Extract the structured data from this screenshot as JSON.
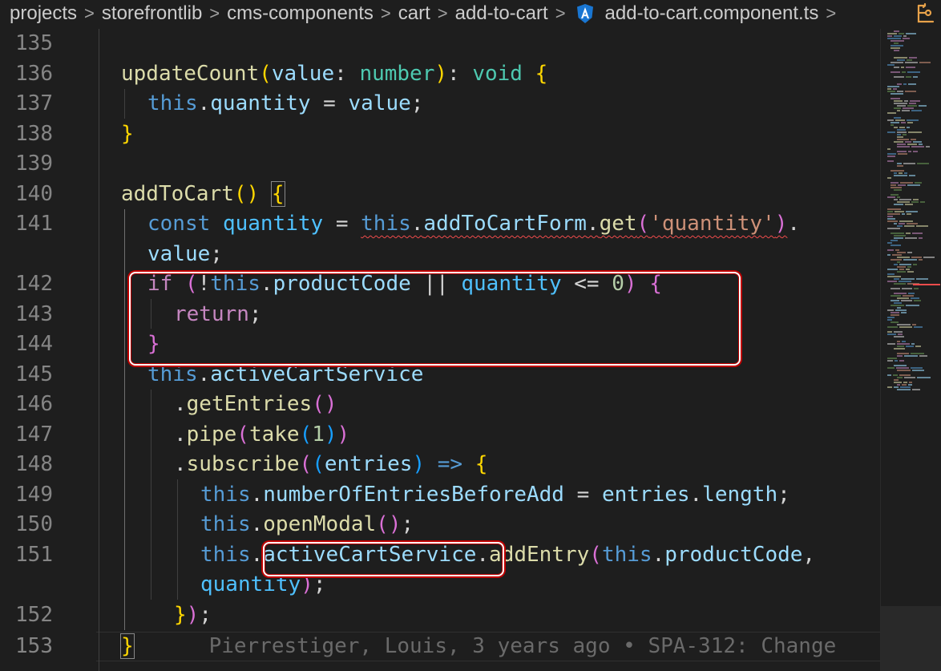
{
  "breadcrumb": {
    "items": [
      "projects",
      "storefrontlib",
      "cms-components",
      "cart",
      "add-to-cart"
    ],
    "file": "add-to-cart.component.ts",
    "separator": ">",
    "icons": {
      "angular": "angular-logo-icon",
      "right": "split-editor-icon"
    }
  },
  "line_numbers": [
    "135",
    "136",
    "137",
    "138",
    "139",
    "140",
    "141",
    "142",
    "143",
    "144",
    "145",
    "146",
    "147",
    "148",
    "149",
    "150",
    "151",
    "152",
    "153"
  ],
  "code": {
    "l136": {
      "name": "updateCount",
      "param": "value",
      "type": "number",
      "ret": "void"
    },
    "l137": {
      "this": "this",
      "prop": "quantity",
      "val": "value"
    },
    "l140": {
      "name": "addToCart"
    },
    "l141": {
      "kw": "const",
      "var": "quantity",
      "this": "this",
      "prop": "addToCartForm",
      "fn": "get",
      "str": "'quantity'"
    },
    "l141b": {
      "prop": "value"
    },
    "l142": {
      "kw": "if",
      "this": "this",
      "prop": "productCode",
      "op": "||",
      "var": "quantity",
      "num": "0"
    },
    "l143": {
      "kw": "return"
    },
    "l145": {
      "this": "this",
      "prop": "activeCartService"
    },
    "l146": {
      "fn": "getEntries"
    },
    "l147": {
      "fn": "pipe",
      "fn2": "take",
      "num": "1"
    },
    "l148": {
      "fn": "subscribe",
      "param": "entries"
    },
    "l149": {
      "this": "this",
      "prop": "numberOfEntriesBeforeAdd",
      "var": "entries",
      "prop2": "length"
    },
    "l150": {
      "this": "this",
      "fn": "openModal"
    },
    "l151": {
      "this": "this",
      "prop": "activeCartService",
      "fn": "addEntry",
      "this2": "this",
      "prop2": "productCode"
    },
    "l151b": {
      "var": "quantity"
    },
    "l153": {
      "blame": "Pierrestiger, Louis, 3 years ago • SPA-312: Change"
    }
  },
  "colors": {
    "accent_box": "#c00000",
    "angular": "#1976d2"
  }
}
